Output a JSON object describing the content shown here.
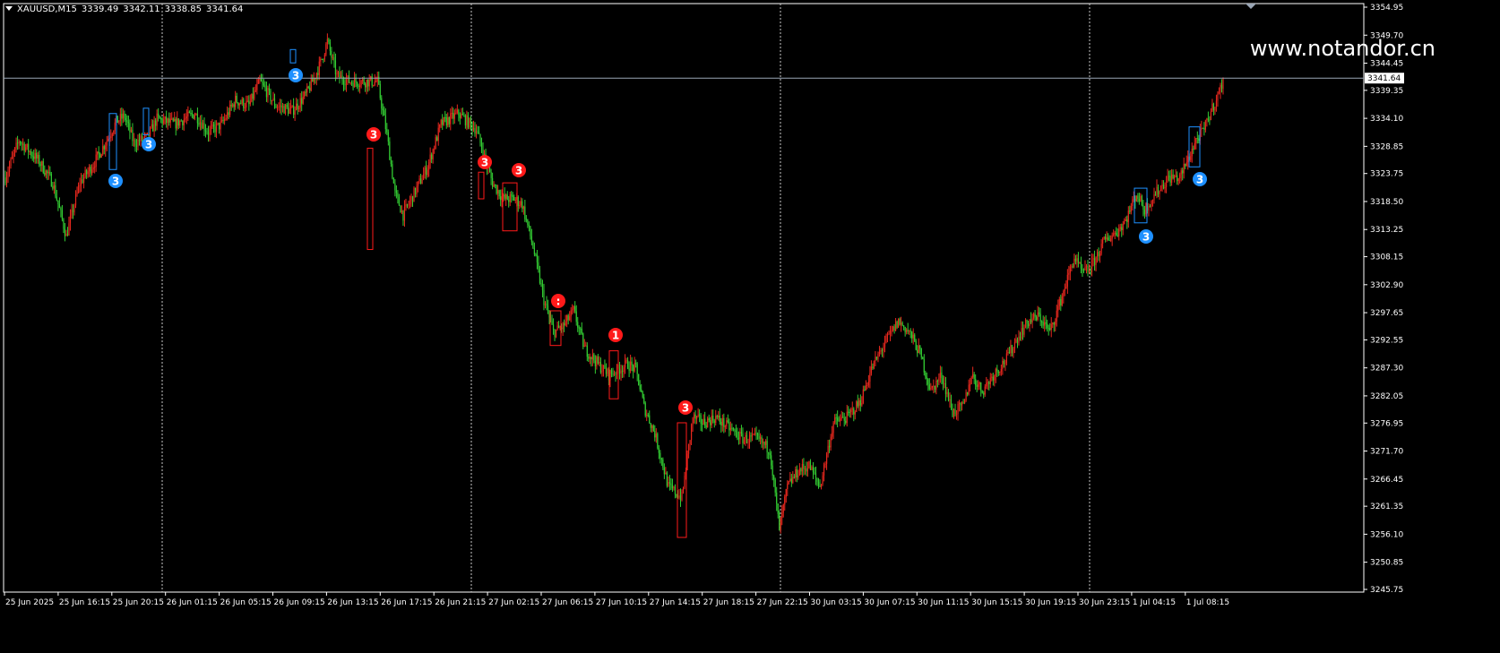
{
  "header": {
    "symbol": "XAUUSD,M15",
    "open": "3339.49",
    "high": "3342.11",
    "low": "3338.85",
    "close": "3341.64"
  },
  "watermark": "www.notandor.cn",
  "colors": {
    "background": "#000000",
    "bull": "#e8281e",
    "bear": "#33cc33",
    "axis": "#ffffff",
    "grid": "#c8c8c8",
    "price_line": "#9aa6b5",
    "marker_blue": "#1e90ff",
    "marker_red": "#ff1a1a"
  },
  "price_axis": {
    "ticks": [
      "3354.95",
      "3349.70",
      "3344.45",
      "3339.35",
      "3334.10",
      "3328.85",
      "3323.75",
      "3318.50",
      "3313.25",
      "3308.15",
      "3302.90",
      "3297.65",
      "3292.55",
      "3287.30",
      "3282.05",
      "3276.95",
      "3271.70",
      "3266.45",
      "3261.35",
      "3256.10",
      "3250.85",
      "3245.75"
    ],
    "current_price": "3341.64"
  },
  "time_axis": {
    "labels": [
      "25 Jun 2025",
      "25 Jun 16:15",
      "25 Jun 20:15",
      "26 Jun 01:15",
      "26 Jun 05:15",
      "26 Jun 09:15",
      "26 Jun 13:15",
      "26 Jun 17:15",
      "26 Jun 21:15",
      "27 Jun 02:15",
      "27 Jun 06:15",
      "27 Jun 10:15",
      "27 Jun 14:15",
      "27 Jun 18:15",
      "27 Jun 22:15",
      "30 Jun 03:15",
      "30 Jun 07:15",
      "30 Jun 11:15",
      "30 Jun 15:15",
      "30 Jun 19:15",
      "30 Jun 23:15",
      "1 Jul 04:15",
      "1 Jul 08:15"
    ]
  },
  "chart_data": {
    "type": "candlestick",
    "symbol": "XAUUSD",
    "timeframe": "M15",
    "ylim": [
      3245.75,
      3356.8
    ],
    "day_separators": [
      "25 Jun 20:15",
      "26 Jun 21:15",
      "27 Jun 22:15",
      "30 Jun 23:15"
    ],
    "path_points": [
      [
        0,
        3323.0
      ],
      [
        10,
        3330.0
      ],
      [
        25,
        3326.0
      ],
      [
        35,
        3322.0
      ],
      [
        45,
        3312.0
      ],
      [
        55,
        3322.0
      ],
      [
        65,
        3325.5
      ],
      [
        75,
        3330.0
      ],
      [
        82,
        3333.5
      ],
      [
        88,
        3334.5
      ],
      [
        95,
        3329.5
      ],
      [
        105,
        3330.5
      ],
      [
        112,
        3334.0
      ],
      [
        125,
        3333.0
      ],
      [
        140,
        3335.0
      ],
      [
        150,
        3331.5
      ],
      [
        160,
        3333.0
      ],
      [
        170,
        3337.5
      ],
      [
        180,
        3336.5
      ],
      [
        188,
        3341.0
      ],
      [
        200,
        3336.5
      ],
      [
        212,
        3335.5
      ],
      [
        222,
        3338.5
      ],
      [
        228,
        3341.5
      ],
      [
        233,
        3344.5
      ],
      [
        238,
        3348.5
      ],
      [
        245,
        3342.0
      ],
      [
        255,
        3341.0
      ],
      [
        265,
        3341.0
      ],
      [
        275,
        3341.0
      ],
      [
        282,
        3331.0
      ],
      [
        288,
        3320.0
      ],
      [
        294,
        3316.0
      ],
      [
        302,
        3320.0
      ],
      [
        312,
        3325.0
      ],
      [
        322,
        3333.0
      ],
      [
        335,
        3335.0
      ],
      [
        348,
        3332.0
      ],
      [
        355,
        3326.0
      ],
      [
        360,
        3322.0
      ],
      [
        368,
        3319.0
      ],
      [
        376,
        3319.0
      ],
      [
        382,
        3318.0
      ],
      [
        390,
        3310.0
      ],
      [
        398,
        3300.0
      ],
      [
        405,
        3294.0
      ],
      [
        412,
        3295.0
      ],
      [
        420,
        3298.0
      ],
      [
        428,
        3291.0
      ],
      [
        438,
        3288.0
      ],
      [
        446,
        3286.0
      ],
      [
        453,
        3287.0
      ],
      [
        460,
        3288.0
      ],
      [
        466,
        3287.0
      ],
      [
        472,
        3280.0
      ],
      [
        480,
        3275.0
      ],
      [
        490,
        3265.0
      ],
      [
        500,
        3263.0
      ],
      [
        508,
        3278.0
      ],
      [
        516,
        3277.0
      ],
      [
        525,
        3278.0
      ],
      [
        535,
        3276.0
      ],
      [
        545,
        3274.0
      ],
      [
        555,
        3274.0
      ],
      [
        565,
        3272.0
      ],
      [
        572,
        3257.0
      ],
      [
        578,
        3265.0
      ],
      [
        586,
        3268.0
      ],
      [
        594,
        3269.0
      ],
      [
        602,
        3265.0
      ],
      [
        612,
        3277.0
      ],
      [
        622,
        3278.0
      ],
      [
        632,
        3281.0
      ],
      [
        640,
        3287.0
      ],
      [
        650,
        3292.0
      ],
      [
        660,
        3296.0
      ],
      [
        668,
        3294.0
      ],
      [
        676,
        3290.0
      ],
      [
        684,
        3283.0
      ],
      [
        692,
        3286.0
      ],
      [
        700,
        3279.0
      ],
      [
        708,
        3280.0
      ],
      [
        714,
        3286.0
      ],
      [
        722,
        3283.0
      ],
      [
        730,
        3286.0
      ],
      [
        740,
        3289.0
      ],
      [
        748,
        3293.0
      ],
      [
        756,
        3296.0
      ],
      [
        764,
        3297.0
      ],
      [
        772,
        3294.0
      ],
      [
        780,
        3300.0
      ],
      [
        790,
        3308.0
      ],
      [
        796,
        3305.0
      ],
      [
        802,
        3306.0
      ],
      [
        812,
        3311.0
      ],
      [
        822,
        3313.0
      ],
      [
        828,
        3315.0
      ],
      [
        836,
        3320.0
      ],
      [
        842,
        3317.0
      ],
      [
        850,
        3320.0
      ],
      [
        860,
        3323.0
      ],
      [
        868,
        3323.0
      ],
      [
        875,
        3327.0
      ],
      [
        880,
        3330.0
      ],
      [
        886,
        3332.0
      ],
      [
        892,
        3336.0
      ],
      [
        898,
        3339.5
      ],
      [
        900,
        3341.64
      ]
    ],
    "day_groups": [
      {
        "markers": [
          {
            "label": "3",
            "color": "blue",
            "box": [
              3335.0,
              3324.5
            ]
          },
          {
            "label": "3",
            "color": "blue",
            "box": [
              3336.0,
              3331.0
            ]
          }
        ]
      },
      {
        "markers": [
          {
            "label": "3",
            "color": "blue",
            "box": [
              3347.0,
              3344.5
            ]
          },
          {
            "label": "3",
            "color": "red",
            "box": [
              3328.5,
              3309.5
            ]
          },
          {
            "label": "3",
            "color": "red",
            "box": [
              3324.0,
              3319.0
            ]
          },
          {
            "label": "3",
            "color": "red",
            "box": [
              3322.0,
              3313.0
            ]
          }
        ]
      },
      {
        "markers": [
          {
            "label": ":",
            "color": "red",
            "box": [
              3298.0,
              3291.5
            ]
          },
          {
            "label": "1",
            "color": "red",
            "box": [
              3290.5,
              3281.5
            ]
          },
          {
            "label": "3",
            "color": "red",
            "box": [
              3277.0,
              3255.5
            ]
          }
        ]
      },
      {
        "markers": [
          {
            "label": "3",
            "color": "blue",
            "box": [
              3321.0,
              3314.5
            ]
          },
          {
            "label": "3",
            "color": "blue",
            "box": [
              3332.5,
              3325.0
            ]
          }
        ]
      }
    ]
  }
}
